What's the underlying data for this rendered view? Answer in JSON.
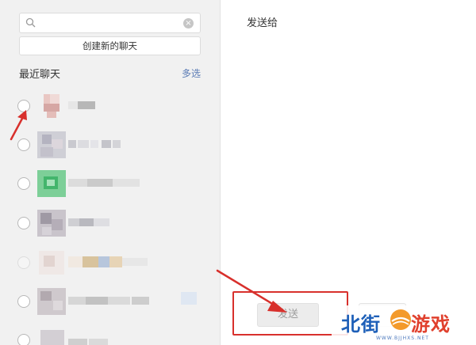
{
  "search": {
    "value": "",
    "placeholder": "",
    "clear_glyph": "×"
  },
  "new_chat_label": "创建新的聊天",
  "recent": {
    "title": "最近聊天",
    "multi_select_label": "多选"
  },
  "send_panel": {
    "send_to_label": "发送给",
    "send_button_label": "发送"
  },
  "watermark": {
    "left_text": "北街",
    "right_text": "游戏",
    "url": "WWW.BJJHXS.NET"
  },
  "colors": {
    "accent_link": "#5a7bb5",
    "annotation_red": "#d8302c",
    "watermark_blue": "#1d5fb8",
    "watermark_red": "#e0402d"
  },
  "icons": {
    "search": "search-icon",
    "clear": "clear-icon",
    "annotation_arrow": "red-arrow-icon"
  }
}
